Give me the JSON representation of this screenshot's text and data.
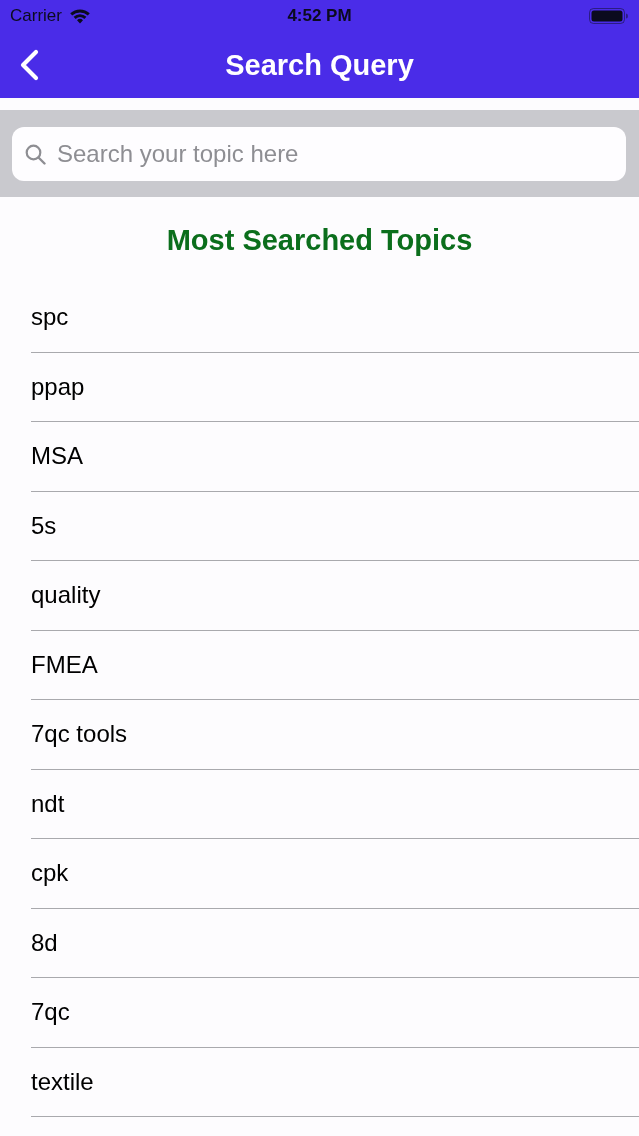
{
  "status_bar": {
    "carrier": "Carrier",
    "time": "4:52 PM"
  },
  "nav_bar": {
    "title": "Search Query"
  },
  "search": {
    "placeholder": "Search your topic here"
  },
  "section_title": "Most Searched Topics",
  "topics": [
    "spc",
    "ppap",
    "MSA",
    "5s",
    "quality",
    "FMEA",
    "7qc tools",
    "ndt",
    "cpk",
    "8d",
    "7qc",
    "textile"
  ]
}
